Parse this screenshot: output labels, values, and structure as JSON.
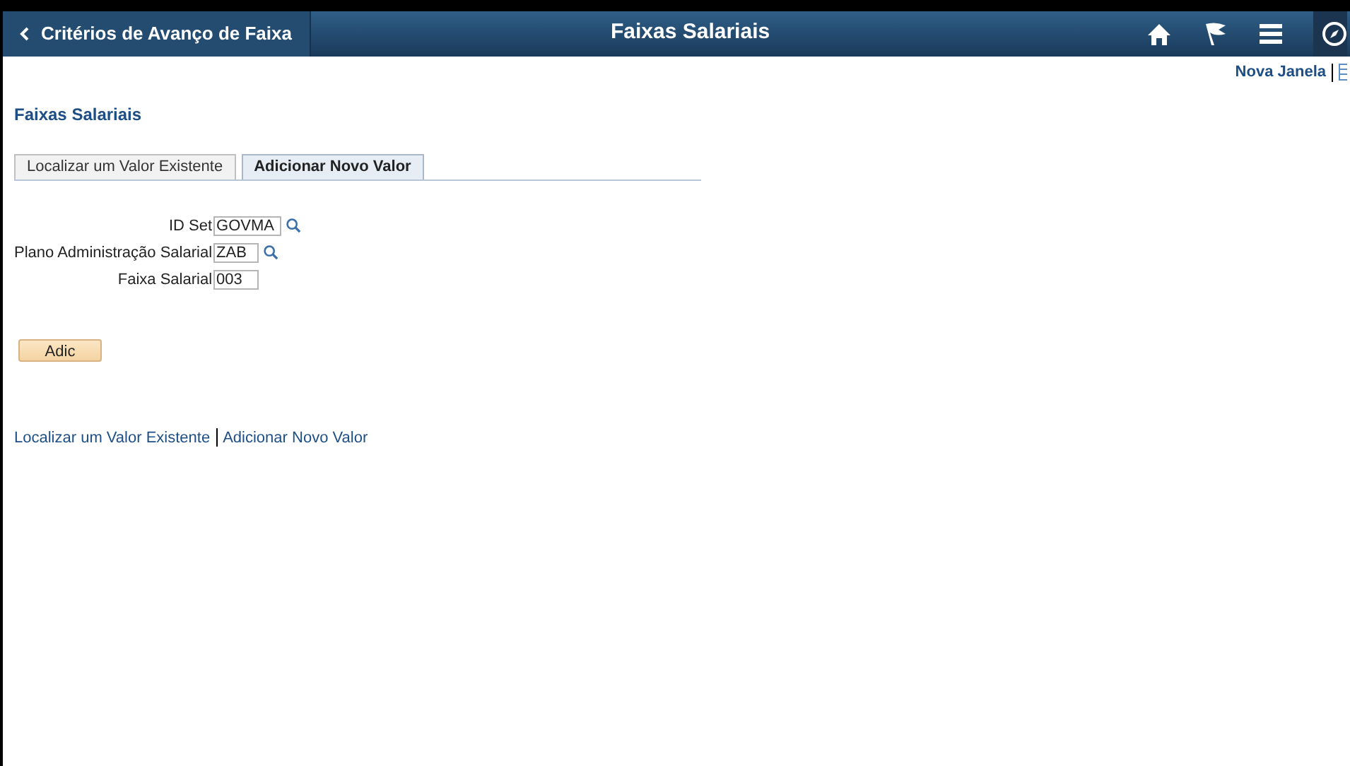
{
  "header": {
    "back_label": "Critérios de Avanço de Faixa",
    "title": "Faixas Salariais"
  },
  "top_link": "Nova Janela",
  "page_title": "Faixas Salariais",
  "tabs": [
    {
      "label": "Localizar um Valor Existente",
      "selected": false
    },
    {
      "label": "Adicionar Novo Valor",
      "selected": true
    }
  ],
  "fields": [
    {
      "label": "ID Set",
      "value": "GOVMA",
      "kind": "lookup"
    },
    {
      "label": "Plano Administração Salarial",
      "value": "ZAB",
      "kind": "lookup"
    },
    {
      "label": "Faixa Salarial",
      "value": "003",
      "kind": "plain"
    }
  ],
  "add_button": "Adic",
  "bottom_links": [
    "Localizar um Valor Existente",
    "Adicionar Novo Valor"
  ]
}
